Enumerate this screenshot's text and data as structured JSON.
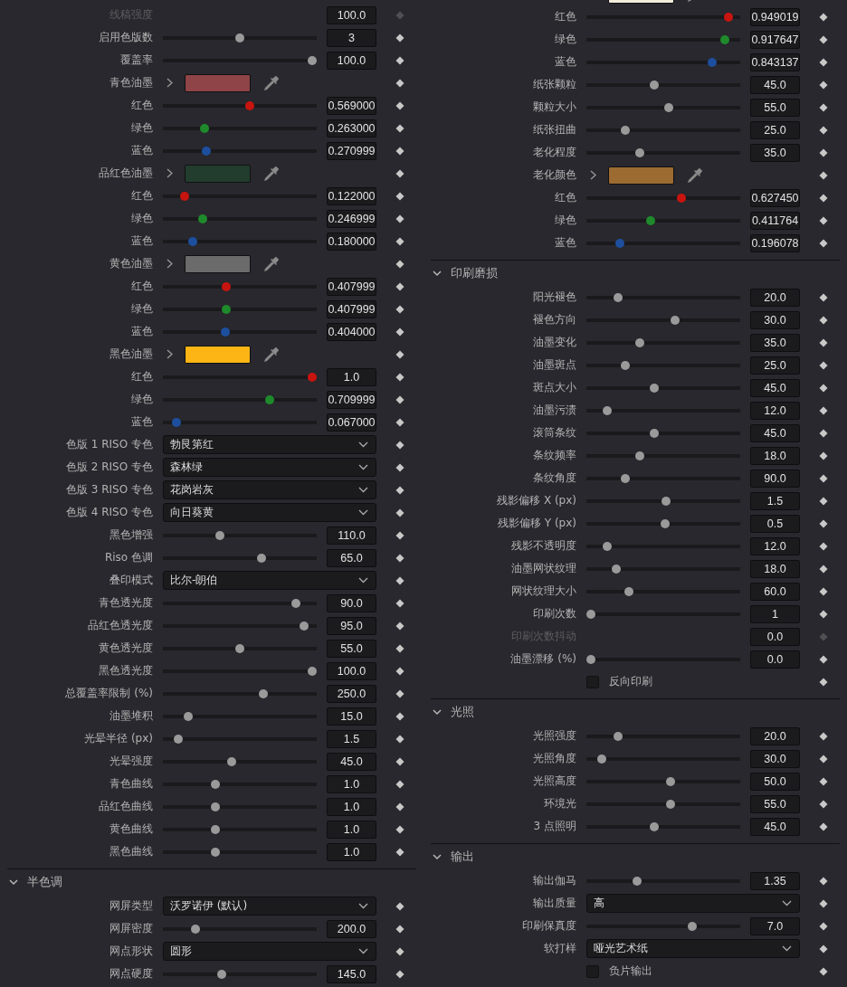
{
  "columns": [
    {
      "rows": [
        {
          "kind": "value",
          "label": "线稿强度",
          "value": "100.0",
          "disabled": true
        },
        {
          "kind": "slider",
          "label": "启用色版数",
          "level": 0.5,
          "value": "3"
        },
        {
          "kind": "slider",
          "label": "覆盖率",
          "level": 1.0,
          "value": "100.0"
        },
        {
          "kind": "swatch",
          "label": "青色油墨",
          "color": "#8f4447"
        },
        {
          "kind": "slider",
          "label": "红色",
          "level": 0.569,
          "value": "0.569000",
          "color": "#c8140f"
        },
        {
          "kind": "slider",
          "label": "绿色",
          "level": 0.256,
          "value": "0.263000",
          "color": "#1f8a2b"
        },
        {
          "kind": "slider",
          "label": "蓝色",
          "level": 0.268,
          "value": "0.270999",
          "color": "#1d4f9e"
        },
        {
          "kind": "swatch",
          "label": "品红色油墨",
          "color": "#223d2d"
        },
        {
          "kind": "slider",
          "label": "红色",
          "level": 0.12,
          "value": "0.122000",
          "color": "#c8140f"
        },
        {
          "kind": "slider",
          "label": "绿色",
          "level": 0.244,
          "value": "0.246999",
          "color": "#1f8a2b"
        },
        {
          "kind": "slider",
          "label": "蓝色",
          "level": 0.175,
          "value": "0.180000",
          "color": "#1d4f9e"
        },
        {
          "kind": "swatch",
          "label": "黄色油墨",
          "color": "#6b6b6b"
        },
        {
          "kind": "slider",
          "label": "红色",
          "level": 0.406,
          "value": "0.407999",
          "color": "#c8140f"
        },
        {
          "kind": "slider",
          "label": "绿色",
          "level": 0.406,
          "value": "0.407999",
          "color": "#1f8a2b"
        },
        {
          "kind": "slider",
          "label": "蓝色",
          "level": 0.4,
          "value": "0.404000",
          "color": "#1d4f9e"
        },
        {
          "kind": "swatch",
          "label": "黑色油墨",
          "color": "#fdb515"
        },
        {
          "kind": "slider",
          "label": "红色",
          "level": 1.0,
          "value": "1.0",
          "color": "#c8140f"
        },
        {
          "kind": "slider",
          "label": "绿色",
          "level": 0.706,
          "value": "0.709999",
          "color": "#1f8a2b"
        },
        {
          "kind": "slider",
          "label": "蓝色",
          "level": 0.0625,
          "value": "0.067000",
          "color": "#1d4f9e"
        },
        {
          "kind": "dropdown",
          "label": "色版 1 RISO 专色",
          "value": "勃艮第红"
        },
        {
          "kind": "dropdown",
          "label": "色版 2 RISO 专色",
          "value": "森林绿"
        },
        {
          "kind": "dropdown",
          "label": "色版 3 RISO 专色",
          "value": "花岗岩灰"
        },
        {
          "kind": "dropdown",
          "label": "色版 4 RISO 专色",
          "value": "向日葵黄"
        },
        {
          "kind": "slider",
          "label": "黑色增强",
          "level": 0.3625,
          "value": "110.0"
        },
        {
          "kind": "slider",
          "label": "Riso 色调",
          "level": 0.65,
          "value": "65.0"
        },
        {
          "kind": "dropdown",
          "label": "叠印模式",
          "value": "比尔-朗伯"
        },
        {
          "kind": "slider",
          "label": "青色透光度",
          "level": 0.8875,
          "value": "90.0"
        },
        {
          "kind": "slider",
          "label": "品红色透光度",
          "level": 0.944,
          "value": "95.0"
        },
        {
          "kind": "slider",
          "label": "黄色透光度",
          "level": 0.5,
          "value": "55.0"
        },
        {
          "kind": "slider",
          "label": "黑色透光度",
          "level": 1.0,
          "value": "100.0"
        },
        {
          "kind": "slider",
          "label": "总覆盖率限制 (%)",
          "level": 0.6625,
          "value": "250.0"
        },
        {
          "kind": "slider",
          "label": "油墨堆积",
          "level": 0.144,
          "value": "15.0"
        },
        {
          "kind": "slider",
          "label": "光晕半径 (px)",
          "level": 0.075,
          "value": "1.5"
        },
        {
          "kind": "slider",
          "label": "光晕强度",
          "level": 0.444,
          "value": "45.0"
        },
        {
          "kind": "slider",
          "label": "青色曲线",
          "level": 0.331,
          "value": "1.0"
        },
        {
          "kind": "slider",
          "label": "品红色曲线",
          "level": 0.331,
          "value": "1.0"
        },
        {
          "kind": "slider",
          "label": "黄色曲线",
          "level": 0.331,
          "value": "1.0"
        },
        {
          "kind": "slider",
          "label": "黑色曲线",
          "level": 0.331,
          "value": "1.0"
        },
        {
          "kind": "section",
          "title": "半色调",
          "expanded": true
        },
        {
          "kind": "dropdown",
          "label": "网屏类型",
          "value": "沃罗诺伊 (默认)"
        },
        {
          "kind": "slider",
          "label": "网屏密度",
          "level": 0.194,
          "value": "200.0"
        },
        {
          "kind": "dropdown",
          "label": "网点形状",
          "value": "圆形"
        },
        {
          "kind": "slider",
          "label": "网点硬度",
          "level": 0.375,
          "value": "145.0"
        }
      ]
    },
    {
      "rows": [
        {
          "kind": "swatch",
          "color": "#f3ecdc"
        },
        {
          "kind": "slider",
          "label": "红色",
          "level": 0.95,
          "value": "0.949019",
          "color": "#c8140f"
        },
        {
          "kind": "slider",
          "label": "绿色",
          "level": 0.923,
          "value": "0.917647",
          "color": "#1f8a2b"
        },
        {
          "kind": "slider",
          "label": "蓝色",
          "level": 0.84,
          "value": "0.843137",
          "color": "#1d4f9e"
        },
        {
          "kind": "slider",
          "label": "纸张颗粒",
          "level": 0.44,
          "value": "45.0"
        },
        {
          "kind": "slider",
          "label": "颗粒大小",
          "level": 0.54,
          "value": "55.0"
        },
        {
          "kind": "slider",
          "label": "纸张扭曲",
          "level": 0.24,
          "value": "25.0"
        },
        {
          "kind": "slider",
          "label": "老化程度",
          "level": 0.34,
          "value": "35.0"
        },
        {
          "kind": "swatch",
          "label": "老化颜色",
          "color": "#9c6b32"
        },
        {
          "kind": "slider",
          "label": "红色",
          "level": 0.625,
          "value": "0.627450",
          "color": "#c8140f"
        },
        {
          "kind": "slider",
          "label": "绿色",
          "level": 0.41,
          "value": "0.411764",
          "color": "#1f8a2b"
        },
        {
          "kind": "slider",
          "label": "蓝色",
          "level": 0.2,
          "value": "0.196078",
          "color": "#1d4f9e"
        },
        {
          "kind": "section",
          "title": "印刷磨损",
          "expanded": true
        },
        {
          "kind": "slider",
          "label": "阳光褪色",
          "level": 0.19,
          "value": "20.0"
        },
        {
          "kind": "slider",
          "label": "褪色方向",
          "level": 0.58,
          "value": "30.0"
        },
        {
          "kind": "slider",
          "label": "油墨变化",
          "level": 0.34,
          "value": "35.0"
        },
        {
          "kind": "slider",
          "label": "油墨斑点",
          "level": 0.24,
          "value": "25.0"
        },
        {
          "kind": "slider",
          "label": "斑点大小",
          "level": 0.44,
          "value": "45.0"
        },
        {
          "kind": "slider",
          "label": "油墨污渍",
          "level": 0.11,
          "value": "12.0"
        },
        {
          "kind": "slider",
          "label": "滚筒条纹",
          "level": 0.44,
          "value": "45.0"
        },
        {
          "kind": "slider",
          "label": "条纹频率",
          "level": 0.34,
          "value": "18.0"
        },
        {
          "kind": "slider",
          "label": "条纹角度",
          "level": 0.24,
          "value": "90.0"
        },
        {
          "kind": "slider",
          "label": "残影偏移 X (px)",
          "level": 0.52,
          "value": "1.5"
        },
        {
          "kind": "slider",
          "label": "残影偏移 Y (px)",
          "level": 0.51,
          "value": "0.5"
        },
        {
          "kind": "slider",
          "label": "残影不透明度",
          "level": 0.11,
          "value": "12.0"
        },
        {
          "kind": "slider",
          "label": "油墨网状纹理",
          "level": 0.175,
          "value": "18.0"
        },
        {
          "kind": "slider",
          "label": "网状纹理大小",
          "level": 0.26,
          "value": "60.0"
        },
        {
          "kind": "slider",
          "label": "印刷次数",
          "level": 0.0,
          "value": "1"
        },
        {
          "kind": "value",
          "label": "印刷次数抖动",
          "value": "0.0",
          "disabled": true
        },
        {
          "kind": "slider",
          "label": "油墨漂移 (%)",
          "level": 0.0,
          "value": "0.0"
        },
        {
          "kind": "checkbox",
          "label": "反向印刷",
          "checked": false
        },
        {
          "kind": "section",
          "title": "光照",
          "expanded": true
        },
        {
          "kind": "slider",
          "label": "光照强度",
          "level": 0.19,
          "value": "20.0"
        },
        {
          "kind": "slider",
          "label": "光照角度",
          "level": 0.075,
          "value": "30.0"
        },
        {
          "kind": "slider",
          "label": "光照高度",
          "level": 0.55,
          "value": "50.0"
        },
        {
          "kind": "slider",
          "label": "环境光",
          "level": 0.55,
          "value": "55.0"
        },
        {
          "kind": "slider",
          "label": "3 点照明",
          "level": 0.44,
          "value": "45.0"
        },
        {
          "kind": "section",
          "title": "输出",
          "expanded": true
        },
        {
          "kind": "slider",
          "label": "输出伽马",
          "level": 0.32,
          "value": "1.35"
        },
        {
          "kind": "dropdown",
          "label": "输出质量",
          "value": "高"
        },
        {
          "kind": "slider",
          "label": "印刷保真度",
          "level": 0.7,
          "value": "7.0"
        },
        {
          "kind": "dropdown",
          "label": "软打样",
          "value": "哑光艺术纸"
        },
        {
          "kind": "checkbox",
          "label": "负片输出",
          "checked": false
        }
      ]
    }
  ]
}
